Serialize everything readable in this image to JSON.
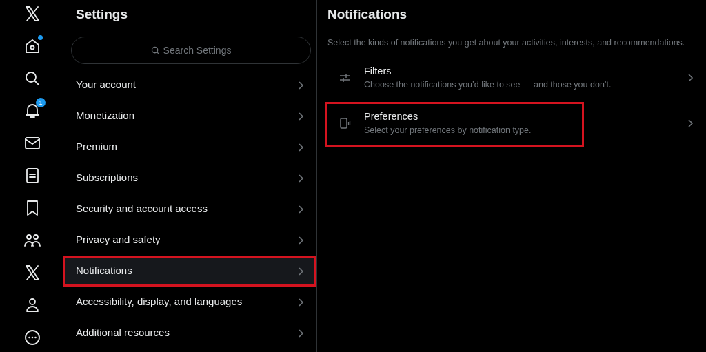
{
  "nav": [
    {
      "kind": "x-logo"
    },
    {
      "kind": "home",
      "dot": true
    },
    {
      "kind": "search"
    },
    {
      "kind": "bell",
      "badge": "1"
    },
    {
      "kind": "mail"
    },
    {
      "kind": "document"
    },
    {
      "kind": "bookmark"
    },
    {
      "kind": "people"
    },
    {
      "kind": "x-logo"
    },
    {
      "kind": "person"
    },
    {
      "kind": "more"
    }
  ],
  "settings": {
    "title": "Settings",
    "search": {
      "placeholder": "Search Settings"
    },
    "items": [
      {
        "label": "Your account",
        "selected": false,
        "highlighted": false
      },
      {
        "label": "Monetization",
        "selected": false,
        "highlighted": false
      },
      {
        "label": "Premium",
        "selected": false,
        "highlighted": false
      },
      {
        "label": "Subscriptions",
        "selected": false,
        "highlighted": false
      },
      {
        "label": "Security and account access",
        "selected": false,
        "highlighted": false
      },
      {
        "label": "Privacy and safety",
        "selected": false,
        "highlighted": false
      },
      {
        "label": "Notifications",
        "selected": true,
        "highlighted": true
      },
      {
        "label": "Accessibility, display, and languages",
        "selected": false,
        "highlighted": false
      },
      {
        "label": "Additional resources",
        "selected": false,
        "highlighted": false
      }
    ]
  },
  "notifications": {
    "title": "Notifications",
    "description": "Select the kinds of notifications you get about your activities, interests, and recommendations.",
    "options": [
      {
        "kind": "filters",
        "title": "Filters",
        "subtitle": "Choose the notifications you’d like to see — and those you don’t.",
        "highlighted": false
      },
      {
        "kind": "preferences",
        "title": "Preferences",
        "subtitle": "Select your preferences by notification type.",
        "highlighted": true
      }
    ]
  }
}
